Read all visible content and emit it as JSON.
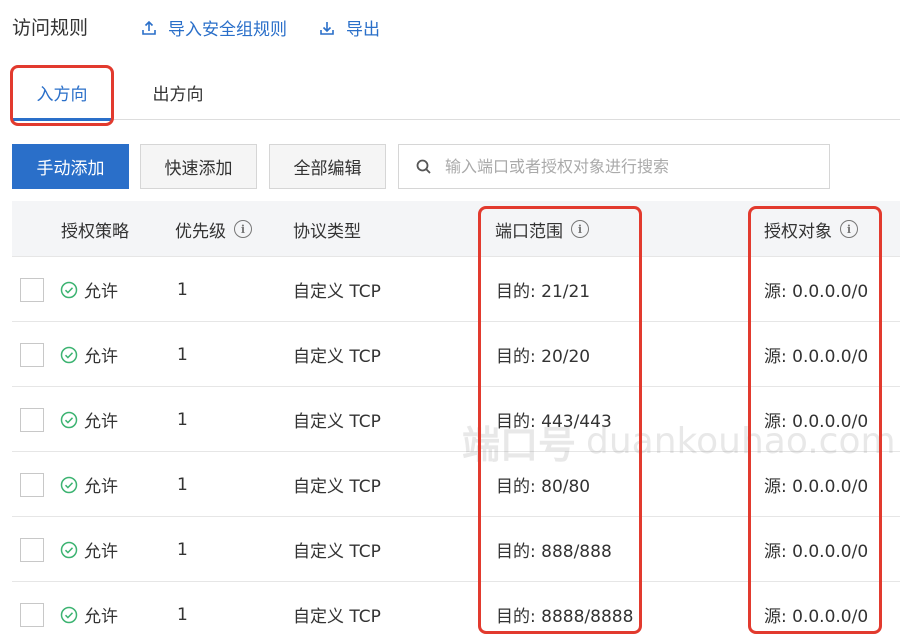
{
  "header": {
    "title": "访问规则",
    "import_label": "导入安全组规则",
    "export_label": "导出"
  },
  "tabs": [
    {
      "label": "入方向",
      "active": true
    },
    {
      "label": "出方向",
      "active": false
    }
  ],
  "toolbar": {
    "manual_add": "手动添加",
    "quick_add": "快速添加",
    "edit_all": "全部编辑",
    "search_placeholder": "输入端口或者授权对象进行搜索"
  },
  "table": {
    "columns": [
      "授权策略",
      "优先级",
      "协议类型",
      "端口范围",
      "授权对象"
    ],
    "rows": [
      {
        "policy": "允许",
        "priority": "1",
        "protocol": "自定义 TCP",
        "port": "目的: 21/21",
        "source": "源: 0.0.0.0/0"
      },
      {
        "policy": "允许",
        "priority": "1",
        "protocol": "自定义 TCP",
        "port": "目的: 20/20",
        "source": "源: 0.0.0.0/0"
      },
      {
        "policy": "允许",
        "priority": "1",
        "protocol": "自定义 TCP",
        "port": "目的: 443/443",
        "source": "源: 0.0.0.0/0"
      },
      {
        "policy": "允许",
        "priority": "1",
        "protocol": "自定义 TCP",
        "port": "目的: 80/80",
        "source": "源: 0.0.0.0/0"
      },
      {
        "policy": "允许",
        "priority": "1",
        "protocol": "自定义 TCP",
        "port": "目的: 888/888",
        "source": "源: 0.0.0.0/0"
      },
      {
        "policy": "允许",
        "priority": "1",
        "protocol": "自定义 TCP",
        "port": "目的: 8888/8888",
        "source": "源: 0.0.0.0/0"
      }
    ]
  },
  "watermark": {
    "brand": "端口号",
    "url": "duankouhao.com"
  },
  "colors": {
    "accent": "#2a6fc9",
    "highlight": "#e23a2e",
    "allow_green": "#3cb371"
  }
}
